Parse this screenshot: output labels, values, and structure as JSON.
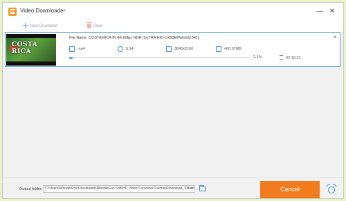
{
  "window": {
    "title": "Video Downloader"
  },
  "toolbar": {
    "new_download_label": "New Download",
    "clear_label": "Clear"
  },
  "task": {
    "thumbnail_text": "COSTA RICA",
    "filename": "File Name: COSTA RICA IN 4K 60fps HDR (ULTRA HD)-LXB3EKWsInQ.f401",
    "format": "mp4",
    "duration": "5:14",
    "resolution": "3840x2160",
    "size": "460.07MB",
    "progress_percent": 2.1,
    "progress_label": "2.1%",
    "eta": "02:18:23"
  },
  "footer": {
    "output_label": "Output folder:",
    "output_path": "C:\\Users\\WonderFox\\Documents\\WonderFox Soft\\HD Video Converter Factory\\Download_Video\\",
    "cancel_label": "Cancel"
  },
  "colors": {
    "accent": "#2f8fdc",
    "cancel_button": "#f07c1f",
    "background_outer": "#e9f3c6"
  },
  "icons": {
    "app": "video-downloader-app-icon",
    "new_download": "plus-icon",
    "clear": "trash-icon",
    "format": "file-icon",
    "duration": "clock-icon",
    "resolution": "resolution-icon",
    "size": "folder-size-icon",
    "eta": "hourglass-icon",
    "folder": "folder-icon",
    "alarm": "alarm-clock-icon"
  }
}
